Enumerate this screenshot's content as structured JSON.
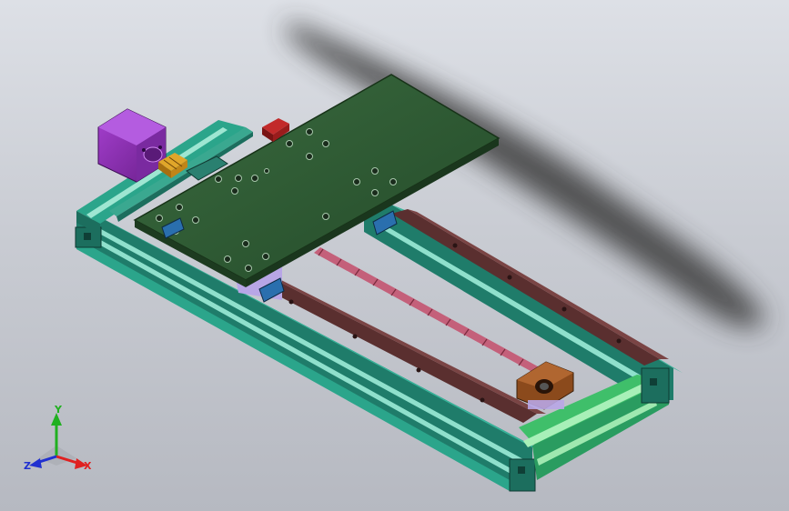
{
  "viewport": {
    "background_top": "#dde0e6",
    "background_bottom": "#b6b9c1"
  },
  "model": {
    "frame_color": "#2a9c86",
    "rail_color": "#5a2f2f",
    "carriage_plate_color": "#2f5a34",
    "motor_color": "#8a2fb0",
    "coupler_color": "#c8901a",
    "leadscrew_color": "#c4607a",
    "bearing_block_color": "#8b4a1c",
    "endcap_color": "#3fbf6a"
  },
  "triad": {
    "x_label": "X",
    "y_label": "Y",
    "z_label": "Z",
    "x_color": "#e02020",
    "y_color": "#20b020",
    "z_color": "#2030d0"
  }
}
